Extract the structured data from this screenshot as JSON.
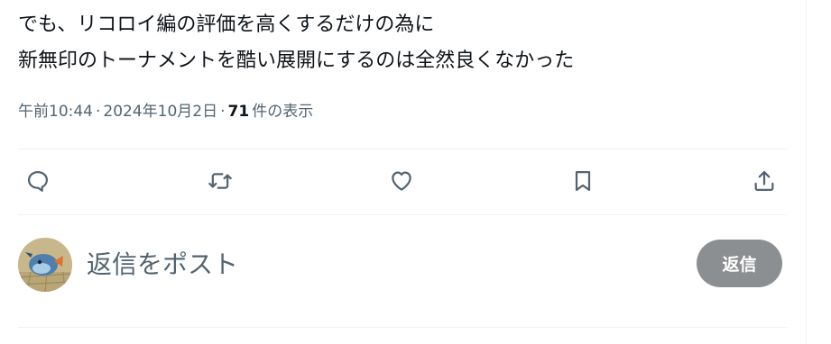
{
  "tweet": {
    "text_lines": [
      "でも、リコロイ編の評価を高くするだけの為に",
      "新無印のトーナメントを酷い展開にするのは全然良くなかった"
    ],
    "time": "午前10:44",
    "separator": "·",
    "date": "2024年10月2日",
    "views_count": "71",
    "views_label": "件の表示"
  },
  "actions": [
    {
      "name": "reply",
      "icon": "speech-bubble-icon"
    },
    {
      "name": "retweet",
      "icon": "retweet-arrows-icon"
    },
    {
      "name": "like",
      "icon": "heart-icon"
    },
    {
      "name": "bookmark",
      "icon": "bookmark-icon"
    },
    {
      "name": "share",
      "icon": "share-upload-icon"
    }
  ],
  "reply_box": {
    "placeholder": "返信をポスト",
    "button_label": "返信"
  },
  "colors": {
    "text_primary": "#0f1419",
    "text_secondary": "#536471",
    "divider": "#eff3f4",
    "reply_button_disabled": "#8c8f91"
  }
}
